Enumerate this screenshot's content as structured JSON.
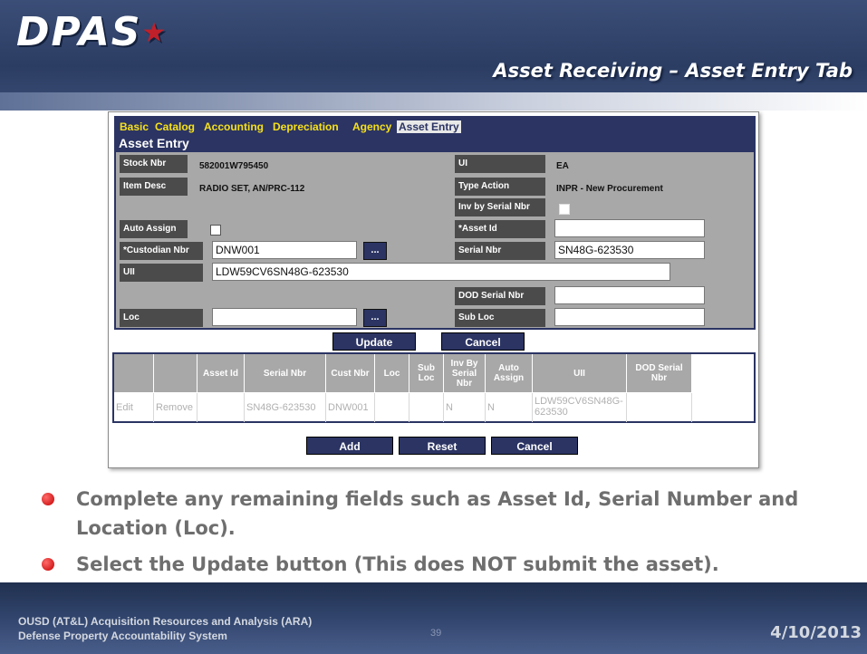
{
  "slide": {
    "logo": "DPAS",
    "title": "Asset Receiving – Asset Entry Tab"
  },
  "tabs": [
    "Basic",
    "Catalog",
    "Accounting",
    "Depreciation",
    "Agency",
    "Asset Entry"
  ],
  "active_tab": "Asset Entry",
  "form": {
    "title": "Asset Entry",
    "stock_nbr_label": "Stock Nbr",
    "stock_nbr": "582001W795450",
    "ui_label": "UI",
    "ui": "EA",
    "item_desc_label": "Item Desc",
    "item_desc": "RADIO SET, AN/PRC-112",
    "type_action_label": "Type Action",
    "type_action": "INPR - New Procurement",
    "inv_by_serial_label": "Inv by Serial Nbr",
    "auto_assign_label": "Auto Assign",
    "asset_id_label": "*Asset Id",
    "asset_id": "",
    "custodian_label": "*Custodian Nbr",
    "custodian": "DNW001",
    "serial_label": "Serial Nbr",
    "serial": "SN48G-623530",
    "uii_label": "UII",
    "uii": "LDW59CV6SN48G-623530",
    "dod_serial_label": "DOD Serial Nbr",
    "dod_serial": "",
    "loc_label": "Loc",
    "loc": "",
    "sub_loc_label": "Sub Loc",
    "sub_loc": "",
    "lookup_label": "...",
    "update_label": "Update",
    "cancel_label": "Cancel"
  },
  "grid": {
    "headers": [
      "",
      "",
      "Asset Id",
      "Serial Nbr",
      "Cust Nbr",
      "Loc",
      "Sub Loc",
      "Inv By Serial Nbr",
      "Auto Assign",
      "UII",
      "DOD Serial Nbr"
    ],
    "row": [
      "Edit",
      "Remove",
      "",
      "SN48G-623530",
      "DNW001",
      "",
      "",
      "N",
      "N",
      "LDW59CV6SN48G-623530",
      ""
    ]
  },
  "actions": {
    "add": "Add",
    "reset": "Reset",
    "cancel": "Cancel"
  },
  "bullets": [
    "Complete any remaining fields such as Asset Id, Serial Number and Location (Loc).",
    "Select the Update button (This does NOT submit the asset)."
  ],
  "footer": {
    "line1": "OUSD (AT&L) Acquisition Resources and Analysis (ARA)",
    "line2": "Defense Property Accountability System",
    "page": "39",
    "date": "4/10/2013"
  }
}
